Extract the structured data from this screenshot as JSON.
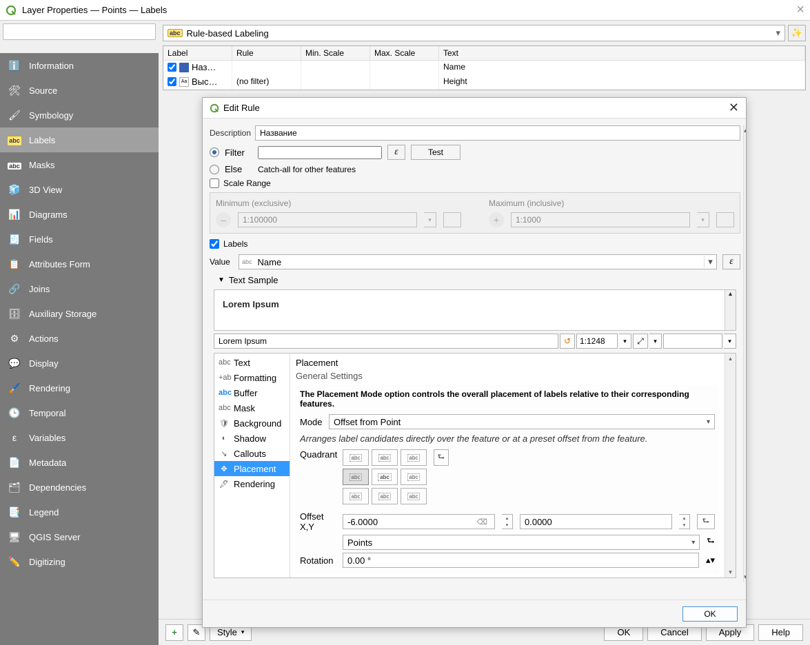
{
  "window": {
    "title": "Layer Properties — Points — Labels"
  },
  "search": {
    "placeholder": ""
  },
  "sidebar": {
    "items": [
      {
        "label": "Information",
        "icon": "info-icon"
      },
      {
        "label": "Source",
        "icon": "source-icon"
      },
      {
        "label": "Symbology",
        "icon": "symbology-icon"
      },
      {
        "label": "Labels",
        "icon": "labels-icon"
      },
      {
        "label": "Masks",
        "icon": "masks-icon"
      },
      {
        "label": "3D View",
        "icon": "cube-icon"
      },
      {
        "label": "Diagrams",
        "icon": "diagrams-icon"
      },
      {
        "label": "Fields",
        "icon": "fields-icon"
      },
      {
        "label": "Attributes Form",
        "icon": "form-icon"
      },
      {
        "label": "Joins",
        "icon": "joins-icon"
      },
      {
        "label": "Auxiliary Storage",
        "icon": "storage-icon"
      },
      {
        "label": "Actions",
        "icon": "actions-icon"
      },
      {
        "label": "Display",
        "icon": "display-icon"
      },
      {
        "label": "Rendering",
        "icon": "rendering-icon"
      },
      {
        "label": "Temporal",
        "icon": "temporal-icon"
      },
      {
        "label": "Variables",
        "icon": "variables-icon"
      },
      {
        "label": "Metadata",
        "icon": "metadata-icon"
      },
      {
        "label": "Dependencies",
        "icon": "dependencies-icon"
      },
      {
        "label": "Legend",
        "icon": "legend-icon"
      },
      {
        "label": "QGIS Server",
        "icon": "server-icon"
      },
      {
        "label": "Digitizing",
        "icon": "digitizing-icon"
      }
    ],
    "selected": 3
  },
  "labeling_mode": "Rule-based Labeling",
  "rules": {
    "columns": [
      "Label",
      "Rule",
      "Min. Scale",
      "Max. Scale",
      "Text"
    ],
    "rows": [
      {
        "checked": true,
        "label": "Наз…",
        "rule": "",
        "min": "",
        "max": "",
        "text": "Name"
      },
      {
        "checked": true,
        "label": "Выс…",
        "rule": "(no filter)",
        "min": "",
        "max": "",
        "text": "Height"
      }
    ]
  },
  "dialog": {
    "title": "Edit Rule",
    "description_label": "Description",
    "description": "Название",
    "filter_label": "Filter",
    "filter_value": "",
    "test_label": "Test",
    "else_label": "Else",
    "else_hint": "Catch-all for other features",
    "scale_range_label": "Scale Range",
    "min_label": "Minimum (exclusive)",
    "max_label": "Maximum (inclusive)",
    "min_value": "1:100000",
    "max_value": "1:1000",
    "labels_checkbox": "Labels",
    "value_label": "Value",
    "value_value": "Name",
    "text_sample_label": "Text Sample",
    "sample_text": "Lorem Ipsum",
    "sample_name": "Lorem Ipsum",
    "sample_scale": "1:1248",
    "tabs": [
      "Text",
      "Formatting",
      "Buffer",
      "Mask",
      "Background",
      "Shadow",
      "Callouts",
      "Placement",
      "Rendering"
    ],
    "selected_tab": 7,
    "placement": {
      "heading": "Placement",
      "general": "General Settings",
      "desc": "The Placement Mode option controls the overall placement of labels relative to their corresponding features.",
      "mode_label": "Mode",
      "mode_value": "Offset from Point",
      "hint": "Arranges label candidates directly over the feature or at a preset offset from the feature.",
      "quadrant_label": "Quadrant",
      "offset_label": "Offset X,Y",
      "offset_x": "-6.0000",
      "offset_y": "0.0000",
      "units_label": "",
      "units_value": "Points",
      "rotation_label": "Rotation",
      "rotation_value": "0.00 °"
    },
    "ok_label": "OK"
  },
  "footer": {
    "style": "Style",
    "ok": "OK",
    "cancel": "Cancel",
    "apply": "Apply",
    "help": "Help"
  }
}
